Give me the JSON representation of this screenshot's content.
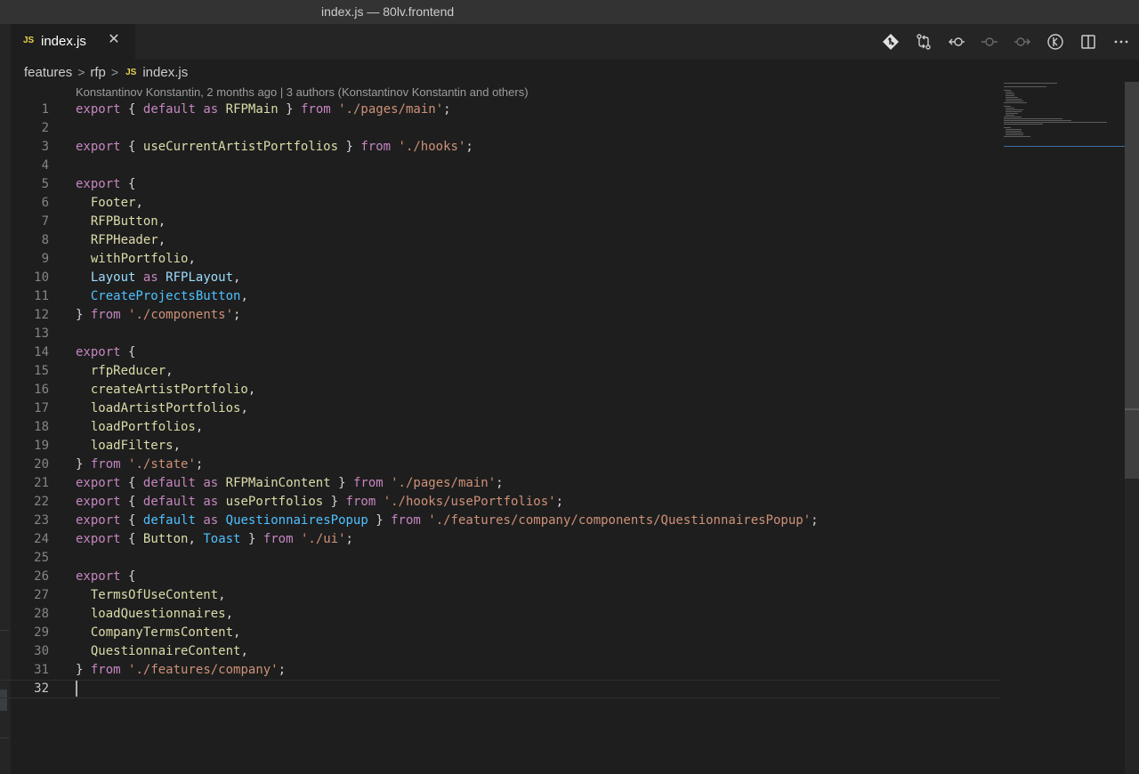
{
  "window": {
    "title": "index.js — 80lv.frontend"
  },
  "tab": {
    "badge": "JS",
    "name": "index.js",
    "close": "✕"
  },
  "breadcrumb": {
    "parts": [
      "features",
      "rfp"
    ],
    "file_badge": "JS",
    "file": "index.js",
    "sep": ">"
  },
  "editor": {
    "blame": "Konstantinov Konstantin, 2 months ago | 3 authors (Konstantinov Konstantin and others)",
    "lines": [
      "1",
      "2",
      "3",
      "4",
      "5",
      "6",
      "7",
      "8",
      "9",
      "10",
      "11",
      "12",
      "13",
      "14",
      "15",
      "16",
      "17",
      "18",
      "19",
      "20",
      "21",
      "22",
      "23",
      "24",
      "25",
      "26",
      "27",
      "28",
      "29",
      "30",
      "31",
      "32"
    ]
  },
  "tokens": {
    "export": "export",
    "from": "from",
    "as": "as",
    "default": "default",
    "ob": "{",
    "cb": "}",
    "semi": ";",
    "comma": ",",
    "RFPMain": "RFPMain",
    "pages_main": "'./pages/main'",
    "useCurrentArtistPortfolios": "useCurrentArtistPortfolios",
    "hooks": "'./hooks'",
    "Footer": "Footer",
    "RFPButton": "RFPButton",
    "RFPHeader": "RFPHeader",
    "withPortfolio": "withPortfolio",
    "Layout": "Layout",
    "RFPLayout": "RFPLayout",
    "CreateProjectsButton": "CreateProjectsButton",
    "components": "'./components'",
    "rfpReducer": "rfpReducer",
    "createArtistPortfolio": "createArtistPortfolio",
    "loadArtistPortfolios": "loadArtistPortfolios",
    "loadPortfolios": "loadPortfolios",
    "loadFilters": "loadFilters",
    "state": "'./state'",
    "RFPMainContent": "RFPMainContent",
    "usePortfolios": "usePortfolios",
    "hooks_usePortfolios": "'./hooks/usePortfolios'",
    "QuestionnairesPopup": "QuestionnairesPopup",
    "qp_path": "'./features/company/components/QuestionnairesPopup'",
    "Button": "Button",
    "Toast": "Toast",
    "ui": "'./ui'",
    "TermsOfUseContent": "TermsOfUseContent",
    "loadQuestionnaires": "loadQuestionnaires",
    "CompanyTermsContent": "CompanyTermsContent",
    "QuestionnaireContent": "QuestionnaireContent",
    "features_company": "'./features/company'"
  },
  "toolbar": {
    "icons": [
      "git-branch-icon",
      "git-compare-icon",
      "go-back-icon",
      "git-commit-icon",
      "go-forward-icon",
      "timeline-icon",
      "split-editor-icon",
      "more-actions-icon"
    ]
  },
  "colors": {
    "keyword": "#c586c0",
    "identifier": "#dcdcaa",
    "type": "#4fc1ff",
    "string": "#ce9178",
    "background": "#1e1e1e"
  }
}
